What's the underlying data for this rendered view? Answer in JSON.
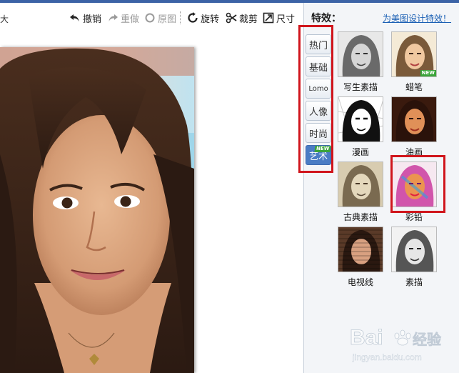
{
  "toolbar": {
    "left_cut_label": "大",
    "undo_label": "撤销",
    "redo_label": "重做",
    "original_label": "原图",
    "rotate_label": "旋转",
    "crop_label": "裁剪",
    "size_label": "尺寸"
  },
  "panel": {
    "title": "特效：",
    "design_link": "为美图设计特效！",
    "categories": [
      {
        "label": "热门"
      },
      {
        "label": "基础"
      },
      {
        "label": "Lomo"
      },
      {
        "label": "人像"
      },
      {
        "label": "时尚"
      },
      {
        "label": "艺术",
        "badge": "NEW"
      }
    ],
    "effects": [
      {
        "label": "写生素描"
      },
      {
        "label": "蜡笔",
        "badge": "NEW"
      },
      {
        "label": "漫画"
      },
      {
        "label": "油画"
      },
      {
        "label": "古典素描"
      },
      {
        "label": "彩铅"
      },
      {
        "label": "电视线"
      },
      {
        "label": "素描"
      }
    ]
  },
  "watermark": {
    "brand": "Bai",
    "brand_suffix": "经验",
    "url": "jingyan.baidu.com"
  },
  "colors": {
    "accent_blue": "#4a7cc4",
    "highlight_red": "#d0151c",
    "new_badge_green": "#3aa43a",
    "link_blue": "#1a5fb4"
  }
}
